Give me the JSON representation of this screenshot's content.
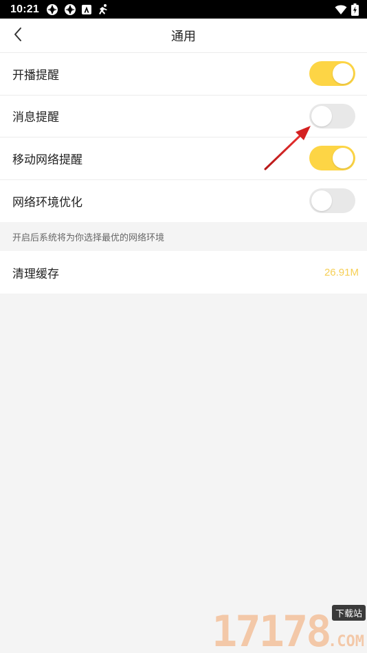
{
  "status_bar": {
    "time": "10:21",
    "icons": [
      "sync-icon",
      "sync-icon",
      "app-icon",
      "running-icon"
    ],
    "right_icons": [
      "wifi-icon",
      "battery-charging-icon"
    ]
  },
  "header": {
    "title": "通用",
    "back_icon": "chevron-left-icon"
  },
  "settings": {
    "items": [
      {
        "label": "开播提醒",
        "enabled": true
      },
      {
        "label": "消息提醒",
        "enabled": false
      },
      {
        "label": "移动网络提醒",
        "enabled": true
      },
      {
        "label": "网络环境优化",
        "enabled": false
      }
    ],
    "hint": "开启后系统将为你选择最优的网络环境"
  },
  "cache": {
    "label": "清理缓存",
    "value": "26.91M"
  },
  "watermark": {
    "number": "17178",
    "badge": "下载站",
    "suffix": ".COM"
  },
  "colors": {
    "toggle_on": "#fdd545",
    "toggle_off": "#e8e8e8",
    "cache_value": "#f6cf55",
    "annotation_arrow": "#d42020"
  }
}
